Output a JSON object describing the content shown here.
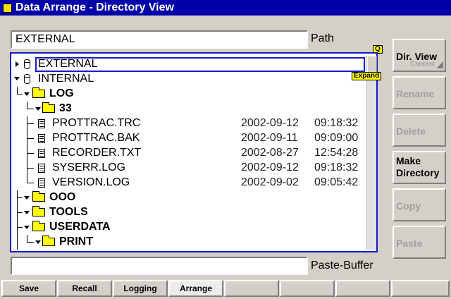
{
  "window": {
    "title": "Data Arrange - Directory View"
  },
  "path": {
    "value": "EXTERNAL",
    "label": "Path"
  },
  "paste_buffer": {
    "value": "",
    "label": "Paste-Buffer"
  },
  "tags": {
    "q": "Q",
    "expand": "Expand"
  },
  "tree": {
    "external": "EXTERNAL",
    "internal": "INTERNAL",
    "log": "LOG",
    "folder_33": "33",
    "files": [
      {
        "name": "PROTTRAC.TRC",
        "date": "2002-09-12",
        "time": "09:18:32"
      },
      {
        "name": "PROTTRAC.BAK",
        "date": "2002-09-11",
        "time": "09:09:00"
      },
      {
        "name": "RECORDER.TXT",
        "date": "2002-08-27",
        "time": "12:54:28"
      },
      {
        "name": "SYSERR.LOG",
        "date": "2002-09-12",
        "time": "09:18:32"
      },
      {
        "name": "VERSION.LOG",
        "date": "2002-09-02",
        "time": "09:05:42"
      }
    ],
    "ooo": "OOO",
    "tools": "TOOLS",
    "userdata": "USERDATA",
    "print": "PRINT"
  },
  "side_buttons": {
    "dir_view": {
      "label": "Dir. View",
      "sub": "Content"
    },
    "rename": "Rename",
    "delete": "Delete",
    "make_directory": {
      "line1": "Make",
      "line2": "Directory"
    },
    "copy": "Copy",
    "paste": "Paste"
  },
  "tabs": [
    "Save",
    "Recall",
    "Logging",
    "Arrange",
    "",
    "",
    "",
    ""
  ]
}
